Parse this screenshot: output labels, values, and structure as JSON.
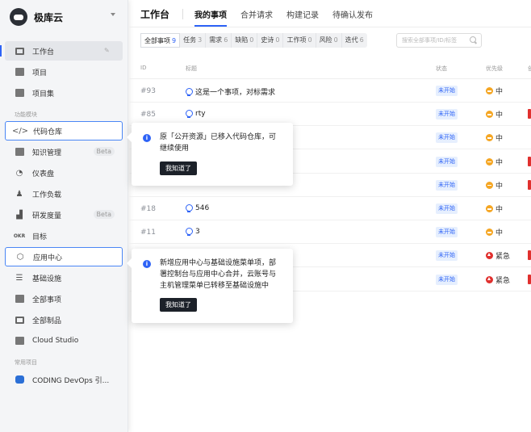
{
  "sidebar": {
    "brand": "极库云",
    "workbench": "工作台",
    "items_main": [
      "项目",
      "项目集"
    ],
    "section_modules": "功能模块",
    "modules": [
      {
        "label": "代码仓库"
      },
      {
        "label": "知识管理",
        "badge": "Beta"
      },
      {
        "label": "仪表盘"
      },
      {
        "label": "工作负载"
      },
      {
        "label": "研发度量",
        "badge": "Beta"
      },
      {
        "label": "目标",
        "icon_text": "OKR"
      },
      {
        "label": "应用中心"
      },
      {
        "label": "基础设施"
      },
      {
        "label": "全部事项"
      },
      {
        "label": "全部制品"
      },
      {
        "label": "Cloud Studio"
      }
    ],
    "section_common": "常用项目",
    "common_project": "CODING DevOps 引..."
  },
  "header": {
    "title": "工作台",
    "tabs": [
      "我的事项",
      "合并请求",
      "构建记录",
      "待确认发布"
    ]
  },
  "filters": [
    {
      "label": "全部事项",
      "count": "9"
    },
    {
      "label": "任务",
      "count": "3"
    },
    {
      "label": "需求",
      "count": "6"
    },
    {
      "label": "缺陷",
      "count": "0"
    },
    {
      "label": "史诗",
      "count": "0"
    },
    {
      "label": "工作项",
      "count": "0"
    },
    {
      "label": "风险",
      "count": "0"
    },
    {
      "label": "迭代",
      "count": "6"
    }
  ],
  "search": {
    "placeholder": "搜索全部事项/ID/标签"
  },
  "table": {
    "headers": {
      "id": "ID",
      "title": "标题",
      "status": "状态",
      "priority": "优先级"
    },
    "rows": [
      {
        "id": "#93",
        "title": "这是一个事项，对标需求",
        "status": "未开始",
        "priority": "中"
      },
      {
        "id": "#85",
        "title": "rty",
        "status": "未开始",
        "priority": "中"
      },
      {
        "id": "",
        "title": "",
        "status": "未开始",
        "priority": "中"
      },
      {
        "id": "",
        "title": "",
        "status": "未开始",
        "priority": "中"
      },
      {
        "id": "",
        "title": "",
        "status": "未开始",
        "priority": "中"
      },
      {
        "id": "#18",
        "title": "546",
        "status": "未开始",
        "priority": "中"
      },
      {
        "id": "#11",
        "title": "3",
        "status": "未开始",
        "priority": "中"
      },
      {
        "id": "",
        "title": "",
        "status": "未开始",
        "priority": "紧急"
      },
      {
        "id": "",
        "title": "",
        "status": "未开始",
        "priority": "紧急"
      }
    ]
  },
  "popover_code": {
    "line1": "原「公开资源」已移入代码仓库，可",
    "line2": "继续使用",
    "button": "我知道了"
  },
  "popover_app": {
    "line1": "新增应用中心与基础设施菜单项，部",
    "line2": "署控制台与应用中心合并，云账号与",
    "line3": "主机管理菜单已转移至基础设施中",
    "button": "我知道了"
  },
  "colors": {
    "accent": "#2e63f6",
    "urgent": "#e0302e",
    "medium": "#f5a623"
  }
}
